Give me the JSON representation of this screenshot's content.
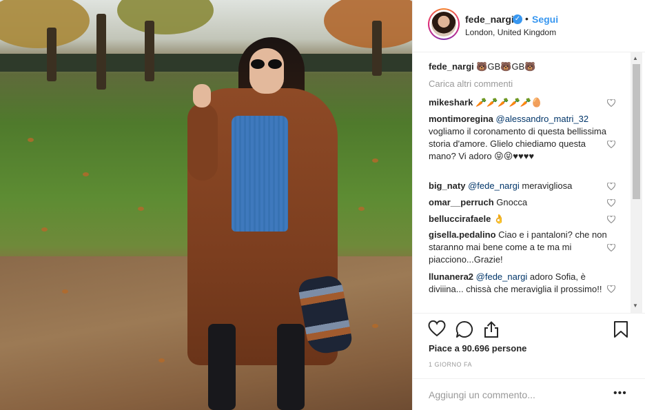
{
  "post": {
    "username": "fede_nargi",
    "verified_icon": "verified-badge-icon",
    "separator": "•",
    "follow_label": "Segui",
    "location": "London, United Kingdom"
  },
  "caption": {
    "username": "fede_nargi",
    "text": "🐻GB🐻GB🐻"
  },
  "load_more_label": "Carica altri commenti",
  "comments": [
    {
      "user": "mikeshark",
      "text": "🥕🥕🥕🥕🥕🥚"
    },
    {
      "user": "montimoregina",
      "mention": "@alessandro_matri_32",
      "text": "vogliamo il coronamento di questa bellissima storia d'amore. Glielo chiediamo questa mano? Vi adoro 😝😝♥♥♥♥"
    },
    {
      "user": "big_naty",
      "mention": "@fede_nargi",
      "text": "meravigliosa"
    },
    {
      "user": "omar__perruch",
      "text": "Gnocca"
    },
    {
      "user": "belluccirafaele",
      "text": "👌"
    },
    {
      "user": "gisella.pedalino",
      "text": "Ciao e i pantaloni? che non staranno mai bene come a te ma mi piacciono...Grazie!"
    },
    {
      "user": "llunanera2",
      "mention": "@fede_nargi",
      "text": "adoro Sofia, è diviiina... chissà che meraviglia il prossimo!!"
    }
  ],
  "likes_text": "Piace a 90.696 persone",
  "date_text": "1 GIORNO FA",
  "comment_input": {
    "placeholder": "Aggiungi un commento...",
    "more": "•••"
  },
  "colors": {
    "link": "#3897f0",
    "text": "#262626",
    "muted": "#999999",
    "mention": "#003569"
  }
}
